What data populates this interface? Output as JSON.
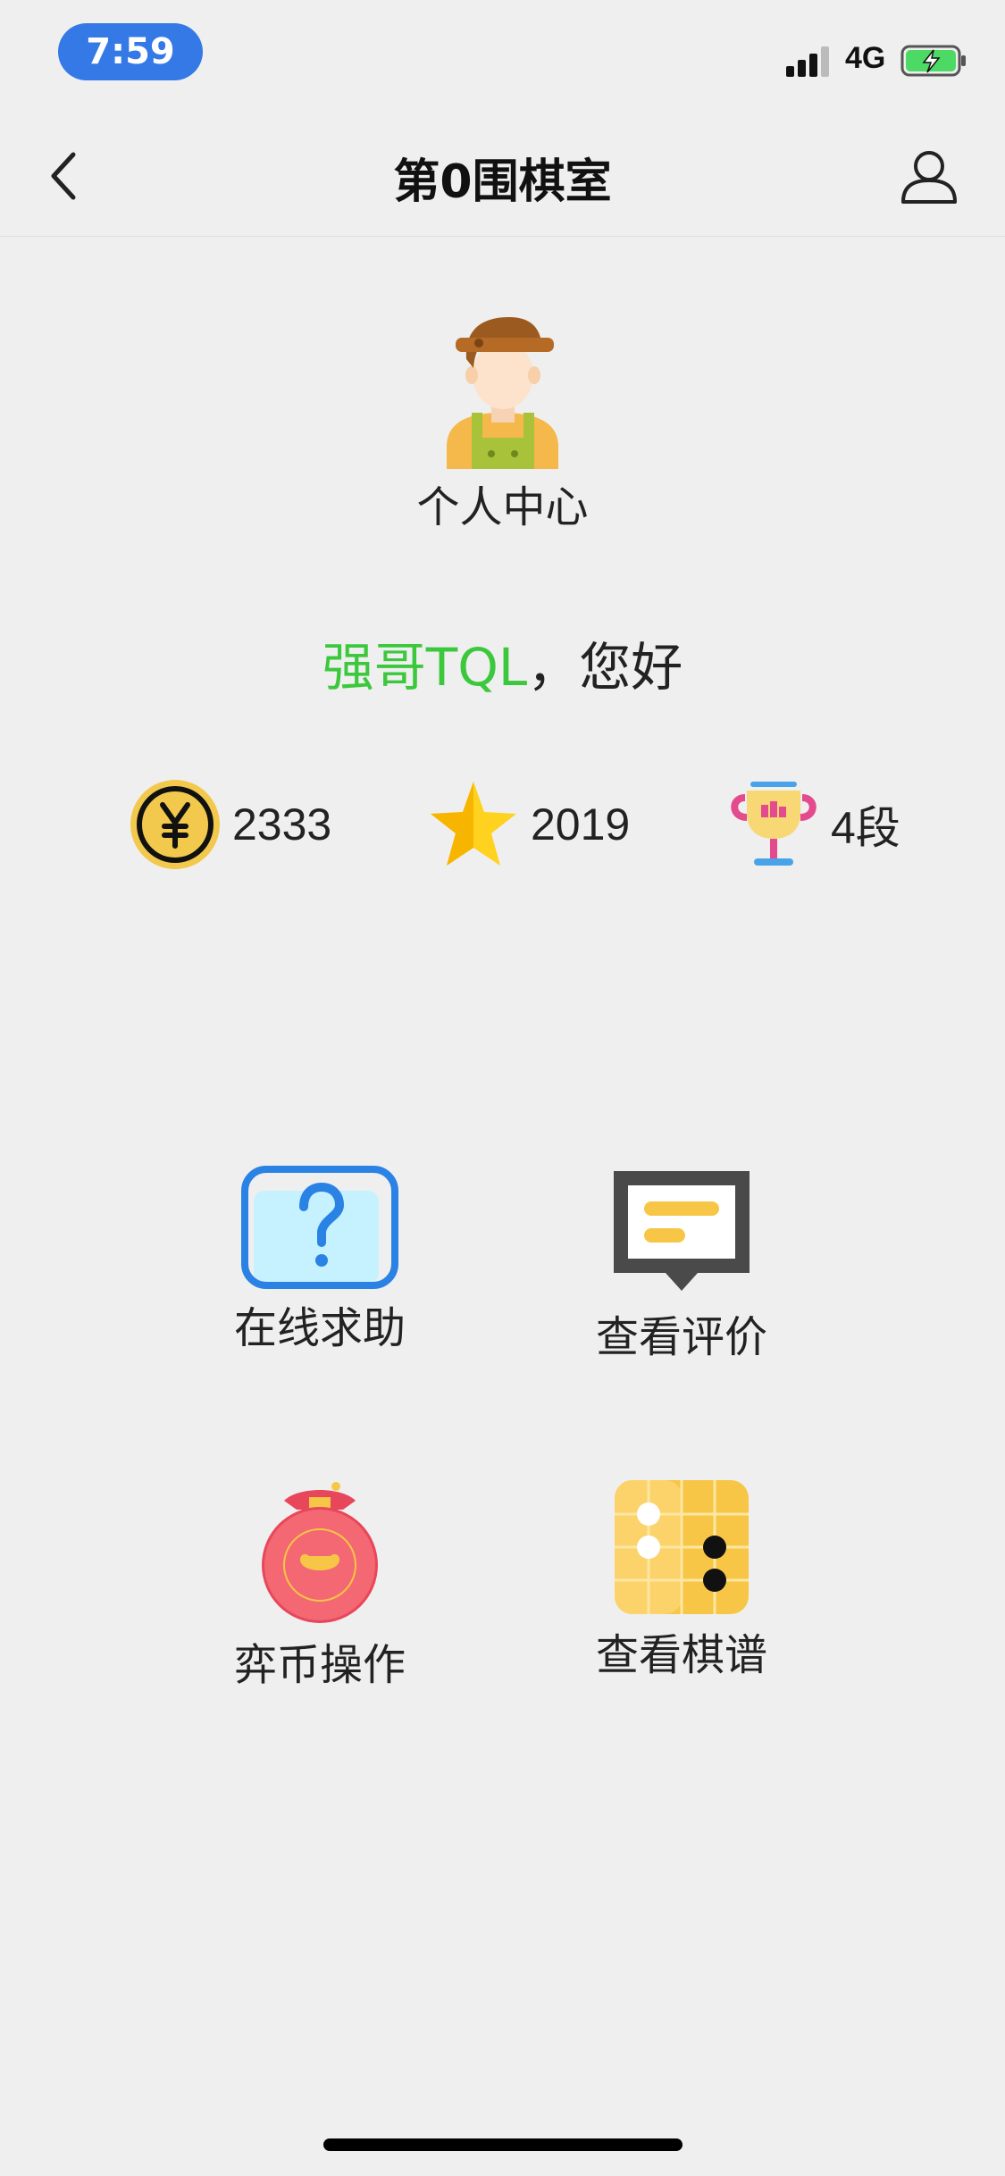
{
  "status_bar": {
    "time": "7:59",
    "network": "4G",
    "battery_color": "#4cd964",
    "pill_color": "#3479e6"
  },
  "nav": {
    "title": "第0围棋室",
    "back_icon": "chevron-left-icon",
    "profile_icon": "user-icon"
  },
  "profile": {
    "label": "个人中心",
    "avatar_icon": "person-avatar-icon"
  },
  "greeting": {
    "name": "强哥TQL",
    "suffix": "，您好",
    "name_color": "#3cc83c"
  },
  "stats": {
    "coins": {
      "icon": "yuan-coin-icon",
      "value": "2333"
    },
    "stars": {
      "icon": "star-icon",
      "value": "2019"
    },
    "rank": {
      "icon": "trophy-icon",
      "value": "4段"
    }
  },
  "menu": {
    "help": {
      "label": "在线求助",
      "icon": "question-icon"
    },
    "reviews": {
      "label": "查看评价",
      "icon": "comment-icon"
    },
    "coin_ops": {
      "label": "弈币操作",
      "icon": "money-bag-icon"
    },
    "records": {
      "label": "查看棋谱",
      "icon": "go-board-icon"
    }
  }
}
